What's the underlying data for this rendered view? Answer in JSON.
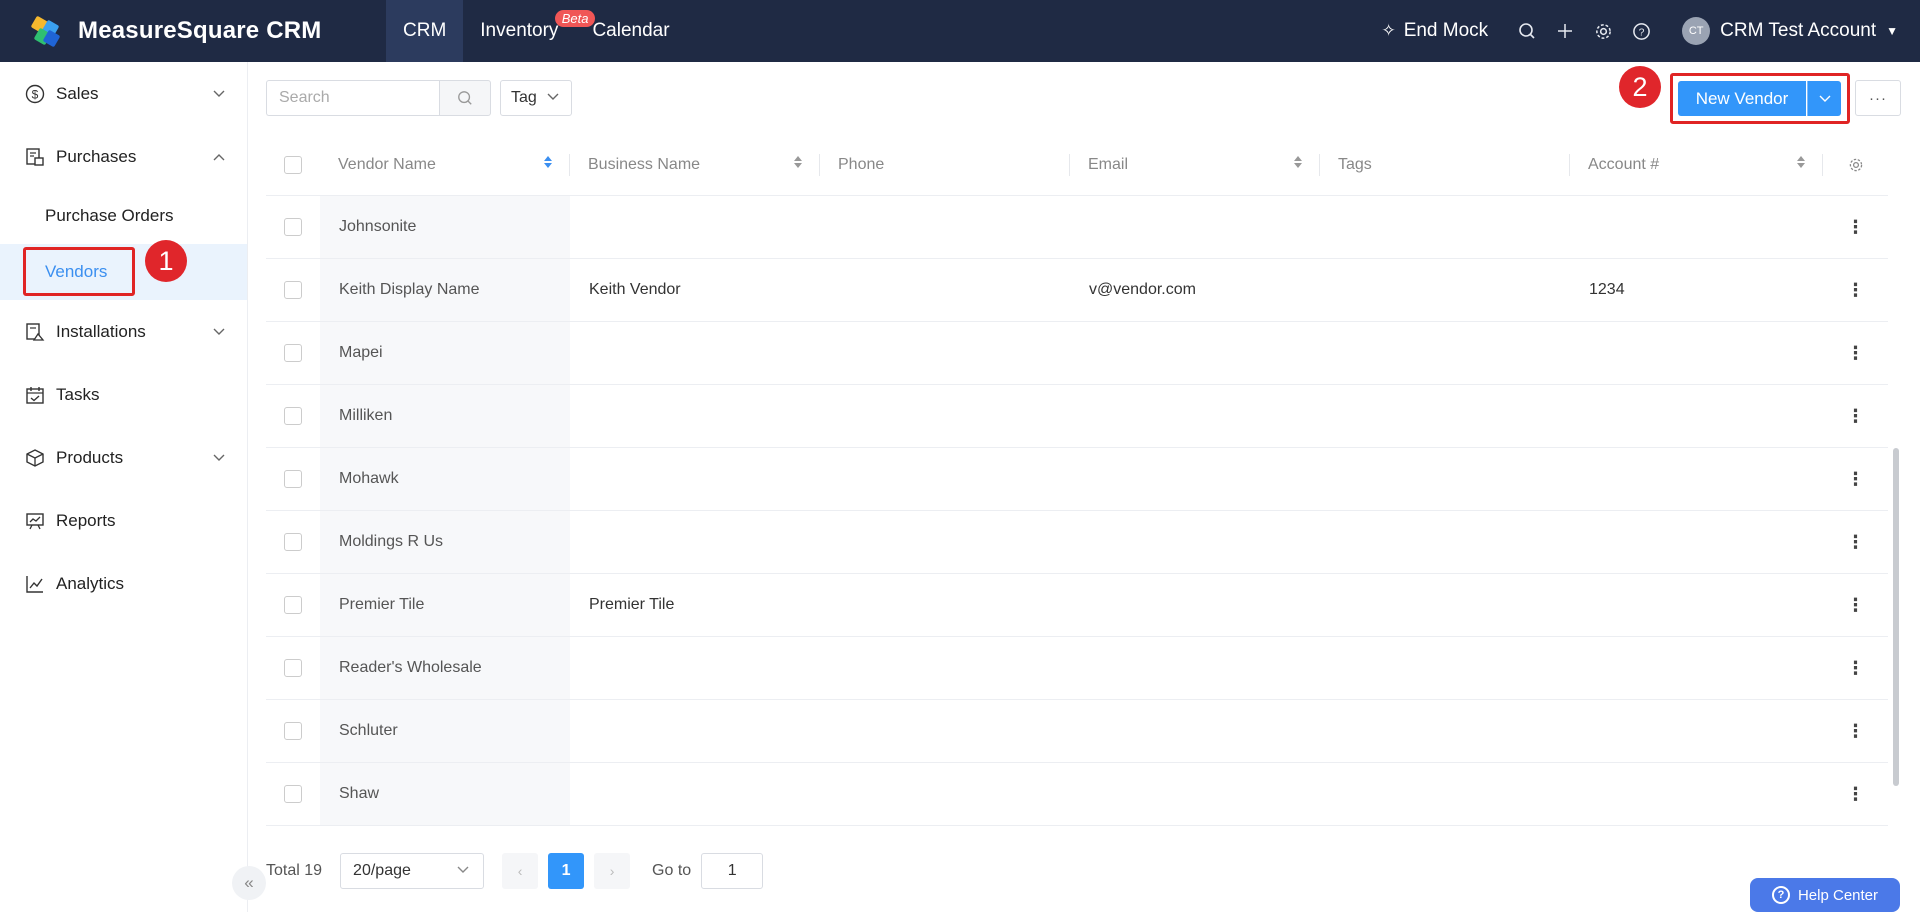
{
  "app": {
    "brand": "MeasureSquare CRM",
    "nav": [
      {
        "label": "CRM",
        "active": true
      },
      {
        "label": "Inventory",
        "badge": "Beta"
      },
      {
        "label": "Calendar"
      }
    ],
    "end_mock": "End Mock",
    "account": {
      "initials": "CT",
      "name": "CRM Test Account"
    }
  },
  "sidebar": {
    "items": [
      {
        "label": "Sales",
        "icon": "dollar-circle-icon"
      },
      {
        "label": "Purchases",
        "icon": "purchases-icon"
      },
      {
        "label": "Purchase Orders"
      },
      {
        "label": "Vendors",
        "active": true
      },
      {
        "label": "Installations",
        "icon": "installations-icon"
      },
      {
        "label": "Tasks",
        "icon": "calendar-check-icon"
      },
      {
        "label": "Products",
        "icon": "box-icon"
      },
      {
        "label": "Reports",
        "icon": "presentation-icon"
      },
      {
        "label": "Analytics",
        "icon": "line-chart-icon"
      }
    ]
  },
  "annotations": {
    "one": "1",
    "two": "2"
  },
  "toolbar": {
    "search_placeholder": "Search",
    "tag_label": "Tag",
    "new_vendor": "New Vendor"
  },
  "table": {
    "columns": [
      "Vendor Name",
      "Business Name",
      "Phone",
      "Email",
      "Tags",
      "Account #"
    ],
    "rows": [
      {
        "name": "Johnsonite",
        "business": "",
        "phone": "",
        "email": "",
        "tags": "",
        "account": ""
      },
      {
        "name": "Keith Display Name",
        "business": "Keith Vendor",
        "phone": "",
        "email": "v@vendor.com",
        "tags": "",
        "account": "1234"
      },
      {
        "name": "Mapei",
        "business": "",
        "phone": "",
        "email": "",
        "tags": "",
        "account": ""
      },
      {
        "name": "Milliken",
        "business": "",
        "phone": "",
        "email": "",
        "tags": "",
        "account": ""
      },
      {
        "name": "Mohawk",
        "business": "",
        "phone": "",
        "email": "",
        "tags": "",
        "account": ""
      },
      {
        "name": "Moldings R Us",
        "business": "",
        "phone": "",
        "email": "",
        "tags": "",
        "account": ""
      },
      {
        "name": "Premier Tile",
        "business": "Premier Tile",
        "phone": "",
        "email": "",
        "tags": "",
        "account": ""
      },
      {
        "name": "Reader's Wholesale",
        "business": "",
        "phone": "",
        "email": "",
        "tags": "",
        "account": ""
      },
      {
        "name": "Schluter",
        "business": "",
        "phone": "",
        "email": "",
        "tags": "",
        "account": ""
      },
      {
        "name": "Shaw",
        "business": "",
        "phone": "",
        "email": "",
        "tags": "",
        "account": ""
      }
    ]
  },
  "pagination": {
    "total": "Total 19",
    "page_size": "20/page",
    "current_page": "1",
    "goto_label": "Go to",
    "goto_value": "1"
  },
  "help_center": "Help Center",
  "colors": {
    "topbar": "#1f2a44",
    "accent": "#3296fa",
    "annotation": "#e02424"
  }
}
